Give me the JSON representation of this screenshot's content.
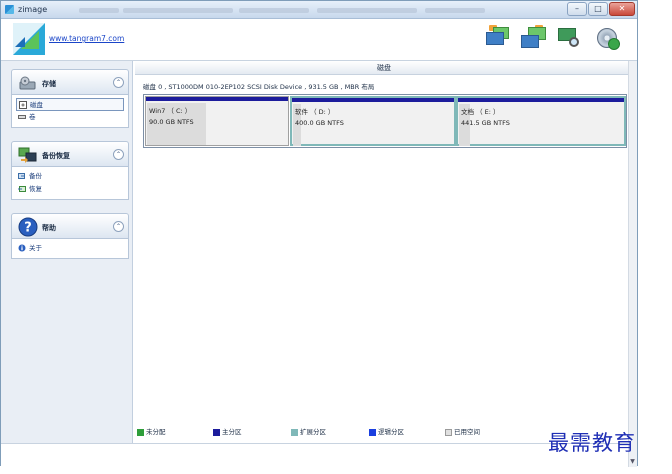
{
  "window": {
    "title": "zimage"
  },
  "header": {
    "site_link": "www.tangram7.com"
  },
  "titlebar": {
    "minimize": "–",
    "maximize": "□",
    "close": "✕"
  },
  "sidebar": {
    "panels": [
      {
        "title": "存储",
        "items": [
          {
            "label": "磁盘",
            "icon": "disk-icon",
            "selected": true
          },
          {
            "label": "卷",
            "icon": "volume-icon",
            "selected": false
          }
        ]
      },
      {
        "title": "备份恢复",
        "items": [
          {
            "label": "备份",
            "icon": "backup-icon",
            "selected": false
          },
          {
            "label": "恢复",
            "icon": "restore-icon",
            "selected": false
          }
        ]
      },
      {
        "title": "帮助",
        "items": [
          {
            "label": "关于",
            "icon": "info-icon",
            "selected": false
          }
        ]
      }
    ],
    "collapse_glyph": "⌃"
  },
  "main": {
    "column_header": "磁盘",
    "disk_title": "磁盘 0 , ST1000DM 010-2EP102 SCSI Disk Device , 931.5 GB , MBR 布局",
    "partitions": [
      {
        "name": "Win7 （ C: ）",
        "size": "90.0 GB NTFS",
        "used_fraction": 0.42,
        "selected": false
      },
      {
        "name": "软件 （ D: ）",
        "size": "400.0 GB NTFS",
        "used_fraction": 0.05,
        "selected": true
      },
      {
        "name": "文档 （ E: ）",
        "size": "441.5 GB NTFS",
        "used_fraction": 0.07,
        "selected": true
      }
    ],
    "legend": [
      {
        "label": "未分配",
        "color": "#2e9e3a"
      },
      {
        "label": "主分区",
        "color": "#1c1c9c"
      },
      {
        "label": "扩展分区",
        "color": "#7fb8b8"
      },
      {
        "label": "逻辑分区",
        "color": "#1a3fe0"
      },
      {
        "label": "已用空间",
        "color": "#e0e0e0"
      }
    ]
  },
  "watermark": "最需教育",
  "colors": {
    "accent": "#1c1c9c",
    "link": "#1a45c8",
    "selection": "#7fb8b8"
  }
}
